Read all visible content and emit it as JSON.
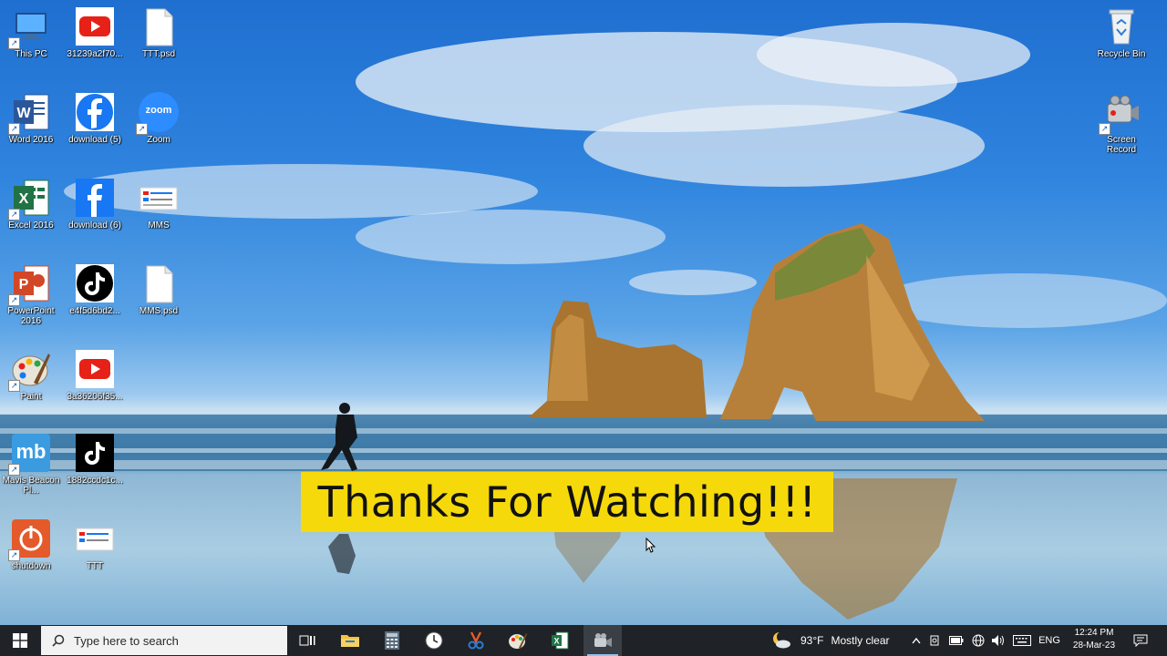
{
  "desktop": {
    "icons_left": [
      {
        "id": "this-pc",
        "label": "This PC"
      },
      {
        "id": "youtube-1",
        "label": "31239a2f70..."
      },
      {
        "id": "ttt-psd",
        "label": "TTT.psd"
      },
      {
        "id": "word",
        "label": "Word 2016"
      },
      {
        "id": "facebook-5",
        "label": "download (5)"
      },
      {
        "id": "zoom",
        "label": "Zoom",
        "glyph_text": "zoom"
      },
      {
        "id": "excel",
        "label": "Excel 2016"
      },
      {
        "id": "facebook-6",
        "label": "download (6)"
      },
      {
        "id": "mms",
        "label": "MMS"
      },
      {
        "id": "powerpoint",
        "label": "PowerPoint 2016"
      },
      {
        "id": "tiktok-1",
        "label": "e4f5d6bd2..."
      },
      {
        "id": "mms-psd",
        "label": "MMS.psd"
      },
      {
        "id": "paint",
        "label": "Paint"
      },
      {
        "id": "youtube-2",
        "label": "3a36206f35..."
      },
      {
        "id": "mavis",
        "label": "Mavis Beacon Pl...",
        "glyph_text": "mb"
      },
      {
        "id": "tiktok-2",
        "label": "1882ccdc1c..."
      },
      {
        "id": "shutdown",
        "label": "shutdown"
      },
      {
        "id": "ttt",
        "label": "TTT"
      }
    ],
    "icons_right": [
      {
        "id": "recycle-bin",
        "label": "Recycle Bin"
      },
      {
        "id": "screen-record",
        "label": "Screen Record"
      }
    ],
    "overlay_caption": "Thanks For Watching!!!"
  },
  "taskbar": {
    "search_placeholder": "Type here to search",
    "weather_temp": "93°F",
    "weather_desc": "Mostly clear",
    "language": "ENG",
    "time": "12:24 PM",
    "date": "28-Mar-23",
    "pinned_apps": [
      "task-view",
      "file-explorer",
      "calculator",
      "clock",
      "snipping-tool",
      "paint",
      "excel",
      "screen-recorder"
    ]
  },
  "colors": {
    "caption_bg": "#f5d90a",
    "taskbar_bg": "#1f2226",
    "youtube_red": "#e62117",
    "facebook_blue": "#1877f2",
    "zoom_blue": "#2d8cff",
    "word_blue": "#2b579a",
    "excel_green": "#217346",
    "ppt_orange": "#d24726"
  }
}
